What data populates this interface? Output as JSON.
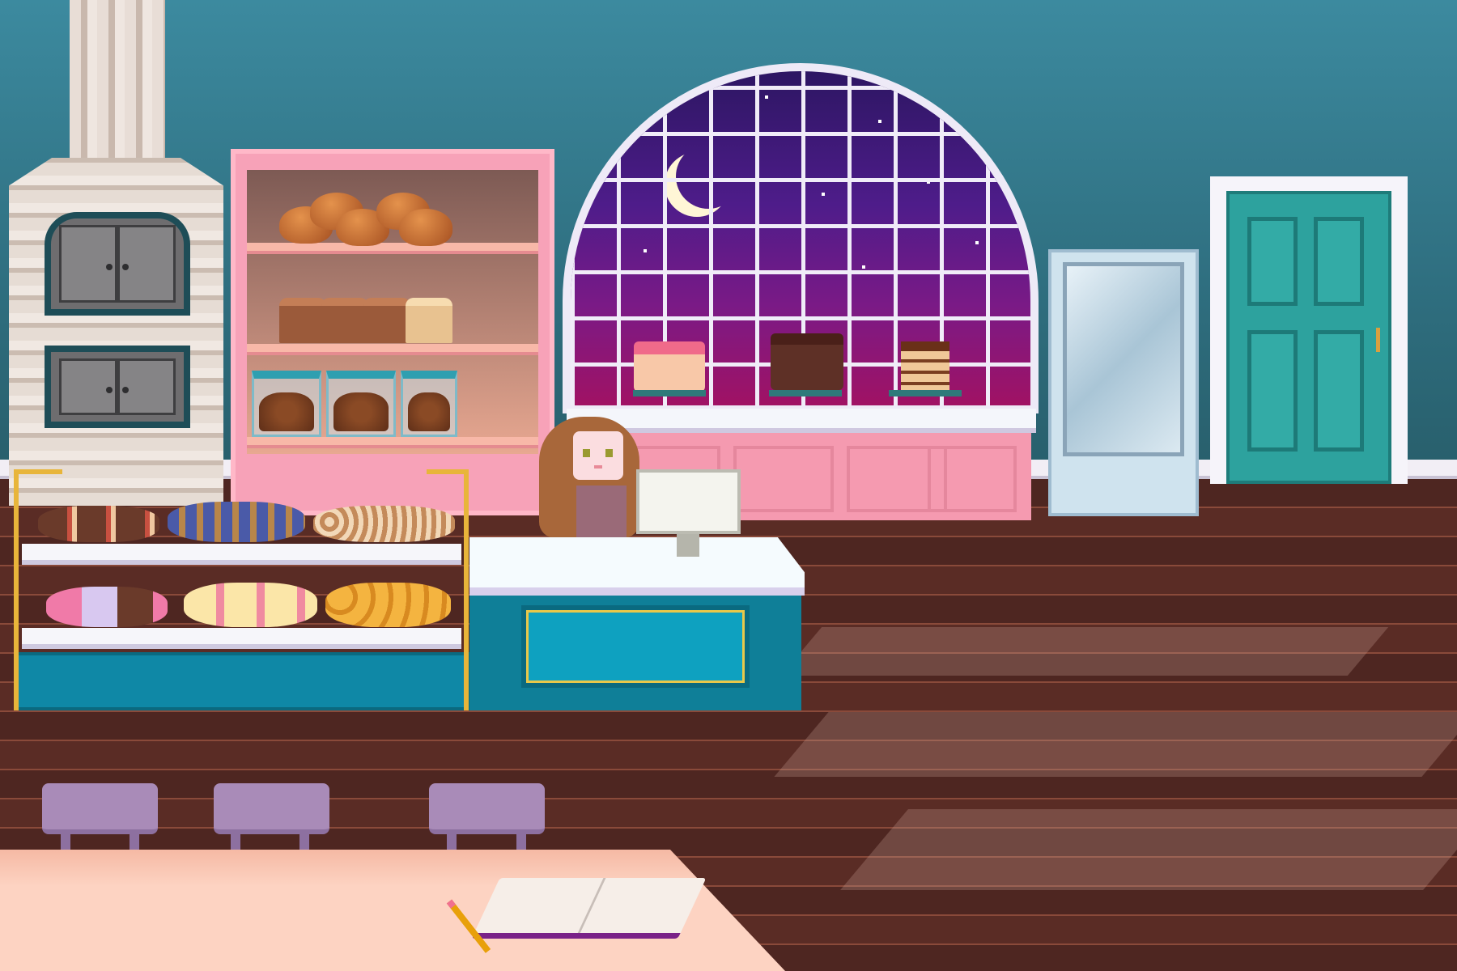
{
  "scene": {
    "location": "bakery",
    "time_of_day": "night",
    "colors": {
      "wall": "#3c8a9f",
      "floor": "#4e2621",
      "shelf": "#f7a2b8",
      "counter": "#0f7f98",
      "window_sky": "#4e1c8a",
      "door": "#2da29e",
      "stool": "#a98bb8",
      "table": "#fdd3c2"
    }
  },
  "objects": {
    "oven": "stone-oven-icon",
    "shelf": "bread-shelf",
    "window": "arched-window",
    "fridge": "glass-fridge",
    "door": "exit-door",
    "character": "baker-girl",
    "monitor": "cash-register-monitor",
    "display_case": "pastry-display-case",
    "book": "open-notebook",
    "pencil": "pencil-icon"
  }
}
